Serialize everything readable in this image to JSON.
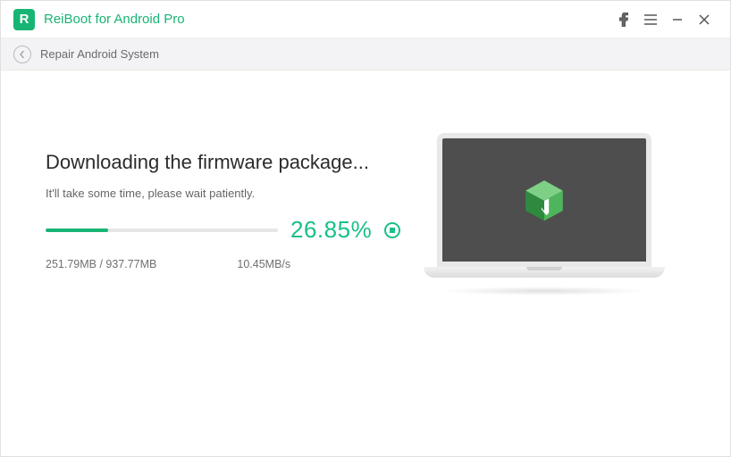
{
  "titlebar": {
    "app_name": "ReiBoot for Android Pro"
  },
  "subheader": {
    "page_title": "Repair Android System"
  },
  "download": {
    "heading": "Downloading the firmware package...",
    "subtext": "It'll take some time, please wait patiently.",
    "percent": "26.85%",
    "progress_value": 26.85,
    "downloaded_mb": "251.79MB",
    "total_mb": "937.77MB",
    "size_text": "251.79MB / 937.77MB",
    "speed": "10.45MB/s"
  },
  "colors": {
    "accent": "#17b573",
    "percent_text": "#18c08a"
  }
}
